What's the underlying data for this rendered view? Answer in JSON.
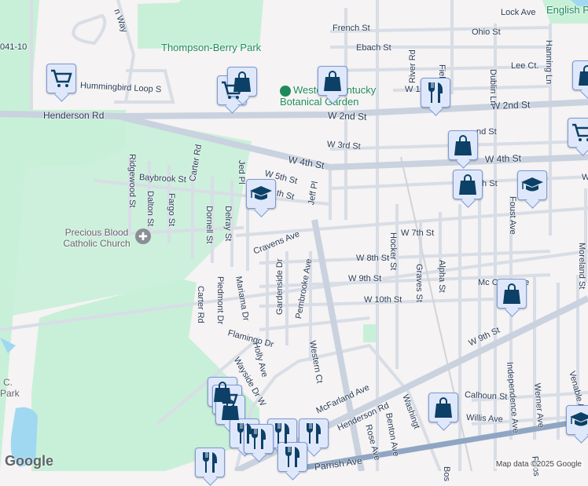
{
  "colors": {
    "park": "#c8f0d8",
    "road": "#d8dde6",
    "major": "#c9d2de",
    "highway": "#8ea6c3",
    "water": "#9fd8f0",
    "marker": "#0d4066",
    "marker_bg": "#dfe8fb",
    "poi": "#1e8a5b"
  },
  "pois": {
    "park1": "Thompson-Berry Park",
    "garden": "Western Kentucky Botanical Garden",
    "english": "English P",
    "church": "Precious Blood Catholic Church",
    "cpark": "C. Park"
  },
  "streets": [
    "Henderson Rd",
    "Hummingbird Loop S",
    "W 2nd St",
    "W 2nd St",
    "W 4th St",
    "W 4th St",
    "W 3rd St",
    "French St",
    "Ohio St",
    "Ebach St",
    "Lock Ave",
    "Lee Ct.",
    "Hanning Ln",
    "Dublin Ln",
    "River Rd",
    "Field",
    "W 1",
    "Jeff Pl",
    "Jed Pl",
    "W 5th St",
    "th St",
    "Baybrook St",
    "Ridgewood St",
    "Dalton St",
    "Fargo St",
    "Carter Rd",
    "Dornell St",
    "Delray St",
    "Cravens Ave",
    "W 7th St",
    "W 8th St",
    "W 9th St",
    "W 10th St",
    "Hocker St",
    "Graves St",
    "Alpha St",
    "Mc Clure Ave",
    "Gardenside Dr",
    "Pembrooke Ave",
    "Carter Rd",
    "Piedmont Dr",
    "Mariama Dr",
    "Flamingo Dr",
    "Holly Ave",
    "Wayside Dr W",
    "Western Ct",
    "W 9th St",
    "McFarland Ave",
    "Henderson Rd",
    "Rose Ave",
    "Benton Ave",
    "Washingt",
    "Calhoun St",
    "Willis Ave",
    "Independence Ave",
    "Werner Ave",
    "Venable A",
    "Moreland St",
    "Foust Ave",
    "Parrish Ave",
    "041-10",
    "nd St",
    "th St",
    "Bos",
    "Roos",
    "n Way",
    "W"
  ],
  "markers": [
    "grocery",
    "grocery",
    "shopping",
    "shopping",
    "restaurant",
    "shopping",
    "shopping",
    "shopping",
    "school",
    "school",
    "shopping",
    "grocery",
    "shopping",
    "shopping",
    "grocery",
    "shopping",
    "restaurant",
    "restaurant",
    "restaurant",
    "restaurant",
    "restaurant",
    "restaurant",
    "school"
  ],
  "attribution": "Map data ©2025 Google",
  "logo": "Google"
}
